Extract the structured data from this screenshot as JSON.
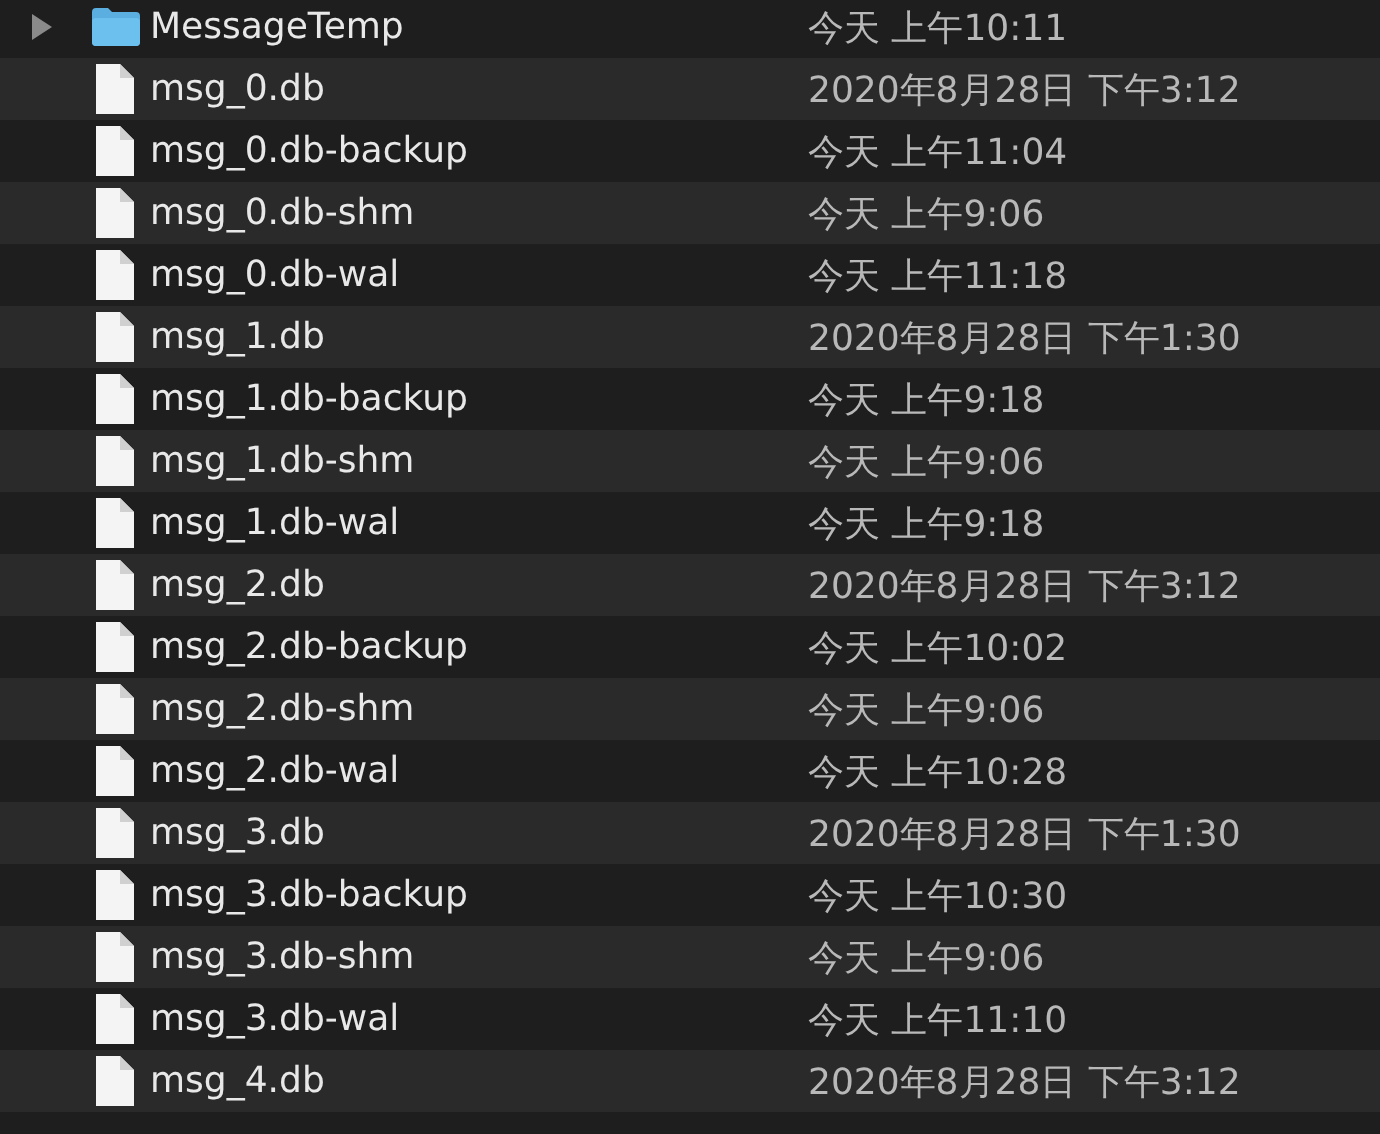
{
  "files": [
    {
      "kind": "folder",
      "name": "MessageTemp",
      "date": "今天 上午10:11",
      "expanded": false
    },
    {
      "kind": "file",
      "name": "msg_0.db",
      "date": "2020年8月28日 下午3:12"
    },
    {
      "kind": "file",
      "name": "msg_0.db-backup",
      "date": "今天 上午11:04"
    },
    {
      "kind": "file",
      "name": "msg_0.db-shm",
      "date": "今天 上午9:06"
    },
    {
      "kind": "file",
      "name": "msg_0.db-wal",
      "date": "今天 上午11:18"
    },
    {
      "kind": "file",
      "name": "msg_1.db",
      "date": "2020年8月28日 下午1:30"
    },
    {
      "kind": "file",
      "name": "msg_1.db-backup",
      "date": "今天 上午9:18"
    },
    {
      "kind": "file",
      "name": "msg_1.db-shm",
      "date": "今天 上午9:06"
    },
    {
      "kind": "file",
      "name": "msg_1.db-wal",
      "date": "今天 上午9:18"
    },
    {
      "kind": "file",
      "name": "msg_2.db",
      "date": "2020年8月28日 下午3:12"
    },
    {
      "kind": "file",
      "name": "msg_2.db-backup",
      "date": "今天 上午10:02"
    },
    {
      "kind": "file",
      "name": "msg_2.db-shm",
      "date": "今天 上午9:06"
    },
    {
      "kind": "file",
      "name": "msg_2.db-wal",
      "date": "今天 上午10:28"
    },
    {
      "kind": "file",
      "name": "msg_3.db",
      "date": "2020年8月28日 下午1:30"
    },
    {
      "kind": "file",
      "name": "msg_3.db-backup",
      "date": "今天 上午10:30"
    },
    {
      "kind": "file",
      "name": "msg_3.db-shm",
      "date": "今天 上午9:06"
    },
    {
      "kind": "file",
      "name": "msg_3.db-wal",
      "date": "今天 上午11:10"
    },
    {
      "kind": "file",
      "name": "msg_4.db",
      "date": "2020年8月28日 下午3:12"
    }
  ]
}
